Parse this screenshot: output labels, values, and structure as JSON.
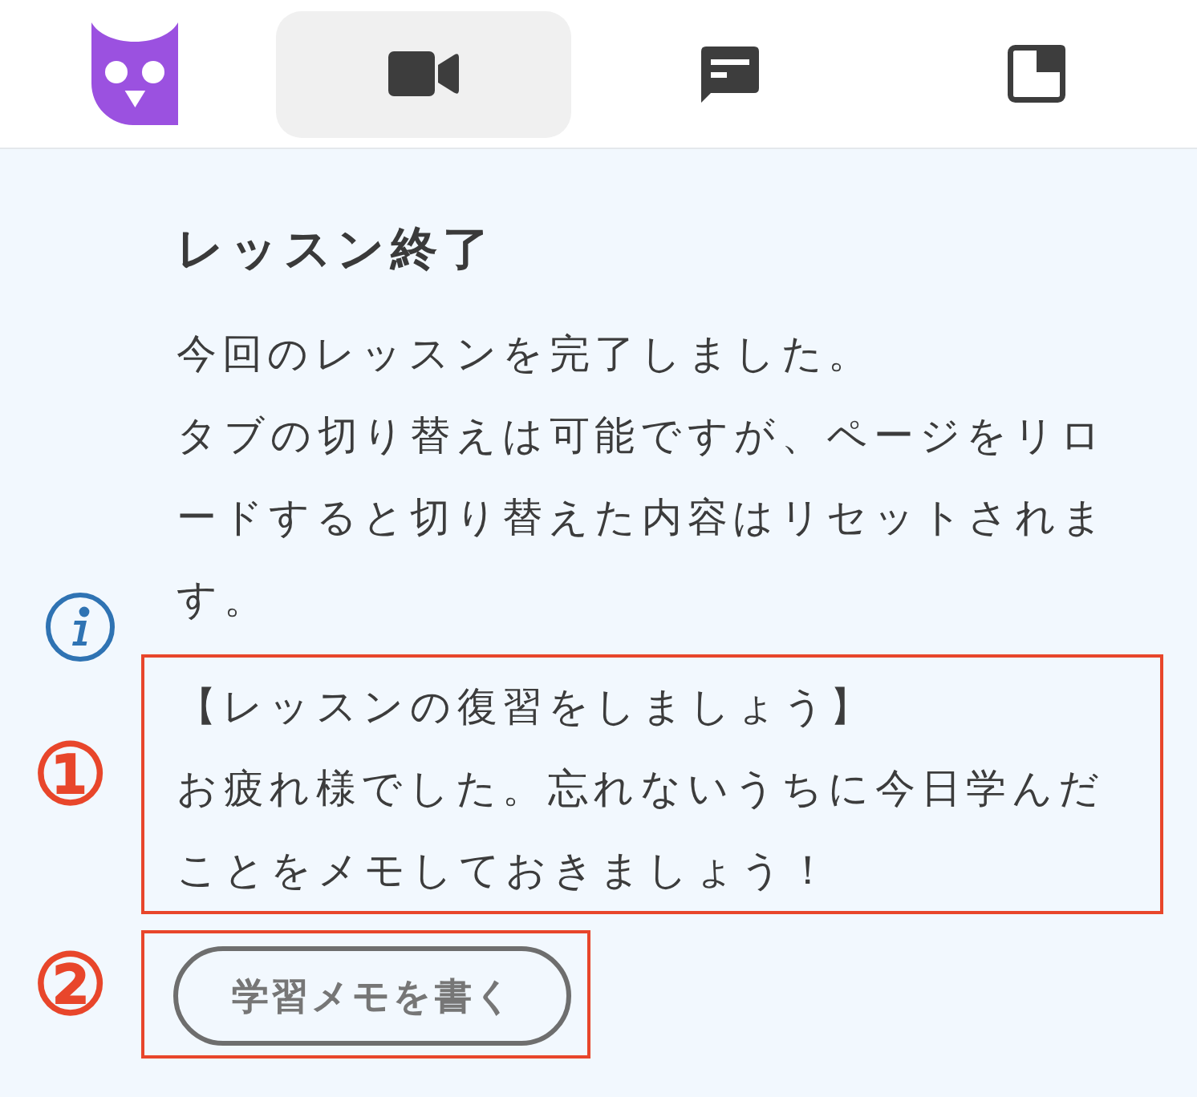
{
  "header": {
    "tabs": [
      {
        "kind": "video",
        "selected": true
      },
      {
        "kind": "chat",
        "selected": false
      },
      {
        "kind": "layout",
        "selected": false
      }
    ]
  },
  "lesson": {
    "title": "レッスン終了",
    "message": [
      "今回のレッスンを完了しました。",
      "タブの切り替えは可能ですが、ページをリロードすると切り替えた内容はリセットされます。"
    ]
  },
  "review": {
    "annotation": "①",
    "heading": "【レッスンの復習をしましょう】",
    "text": "お疲れ様でした。忘れないうちに今日学んだことをメモしておきましょう！"
  },
  "memo_button": {
    "annotation": "②",
    "label": "学習メモを書く"
  }
}
